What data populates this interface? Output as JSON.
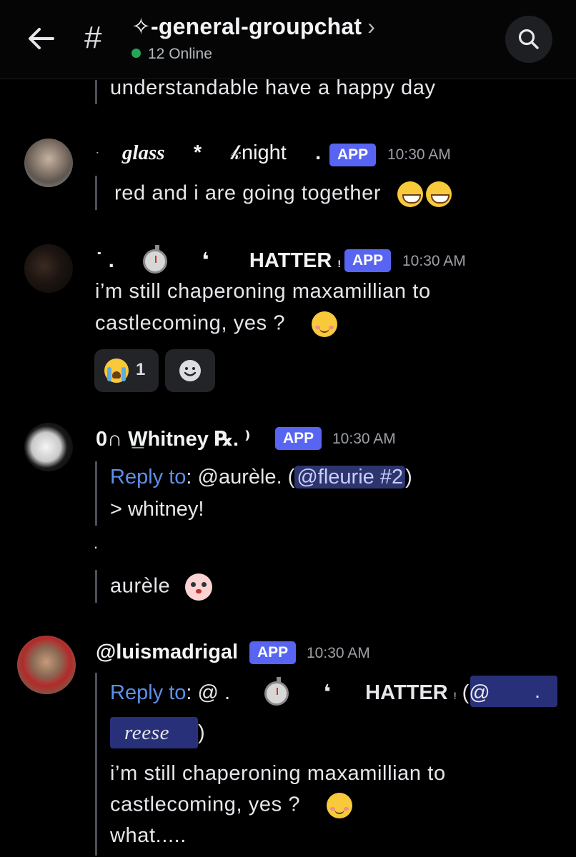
{
  "header": {
    "title": "✧-general-groupchat",
    "chevron": "›",
    "online": "12 Online",
    "back_icon": "back-arrow-icon",
    "search_icon": "search-icon"
  },
  "messages": {
    "prev_tail": "understandable have a happy day",
    "m1": {
      "name_a": "glass",
      "star": "*",
      "name_b": "𝓀night",
      "dot": ".",
      "app": "APP",
      "time": "10:30 AM",
      "text": "red  and  i  are  going  together"
    },
    "m2": {
      "name_pre": "˙ .",
      "name_mark": "❛",
      "name": "HATTER",
      "name_post": "!",
      "app": "APP",
      "time": "10:30 AM",
      "line1": "i’m  still  chaperoning  maxamillian  to",
      "line2": "castlecoming,    yes  ?",
      "reaction_count": "1"
    },
    "m3": {
      "name": "0∩ W̲hitney ℞. ⁾",
      "app": "APP",
      "time": "10:30 AM",
      "reply_label": "Reply to",
      "reply_colon": ":",
      "reply_user": " @aurèle. (",
      "reply_mention": "@fleurie #2",
      "reply_close": ")",
      "quote": "> whitney!",
      "dot": ".",
      "text": "aurèle"
    },
    "m4": {
      "name": "@luismadrigal",
      "app": "APP",
      "time": "10:30 AM",
      "reply_label": "Reply to",
      "reply_colon": ":",
      "reply_at": " @   .",
      "reply_mark": "❛",
      "reply_name": "HATTER",
      "reply_excl": "!",
      "reply_paren": "(@",
      "reply_tail": ".",
      "reply_tag": "reese",
      "reply_close": ")",
      "line1": "i’m  still  chaperoning  maxamillian  to",
      "line2": "castlecoming,    yes  ?",
      "line3": "what....."
    }
  }
}
